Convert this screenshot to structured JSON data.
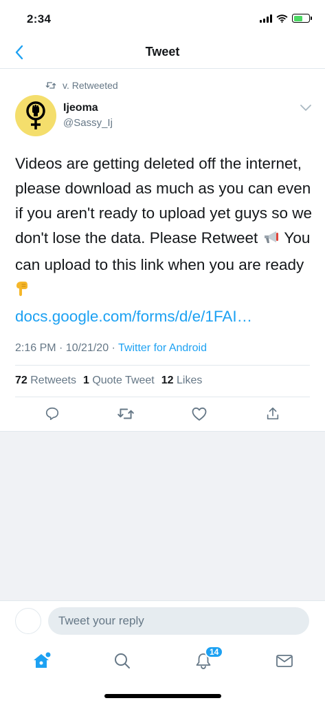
{
  "status_bar": {
    "time": "2:34"
  },
  "nav": {
    "title": "Tweet"
  },
  "tweet": {
    "retweeted_by": "v. Retweeted",
    "author_name": "Ijeoma",
    "author_handle": "@Sassy_Ij",
    "text_part1": "Videos are getting deleted off the internet, please download as much as you can even if you aren't ready to upload yet guys so we don't lose the data. Please Retweet ",
    "text_part2": " You can upload to this link when you are ready ",
    "link": "docs.google.com/forms/d/e/1FAI…",
    "timestamp": "2:16 PM · 10/21/20 · ",
    "source": "Twitter for Android",
    "retweets_count": "72",
    "retweets_label": "Retweets",
    "quotes_count": "1",
    "quotes_label": "Quote Tweet",
    "likes_count": "12",
    "likes_label": "Likes"
  },
  "reply": {
    "placeholder": "Tweet your reply"
  },
  "tab_bar": {
    "notifications_badge": "14"
  },
  "colors": {
    "accent": "#1da1f2",
    "secondary_text": "#657786",
    "avatar_bg": "#f4de6c"
  },
  "icons": [
    "back-chevron-icon",
    "retweet-icon",
    "feminist-fist-icon",
    "chevron-down-icon",
    "megaphone-emoji",
    "pointing-down-emoji",
    "reply-icon",
    "heart-icon",
    "share-icon",
    "home-icon",
    "search-icon",
    "bell-icon",
    "mail-icon"
  ]
}
